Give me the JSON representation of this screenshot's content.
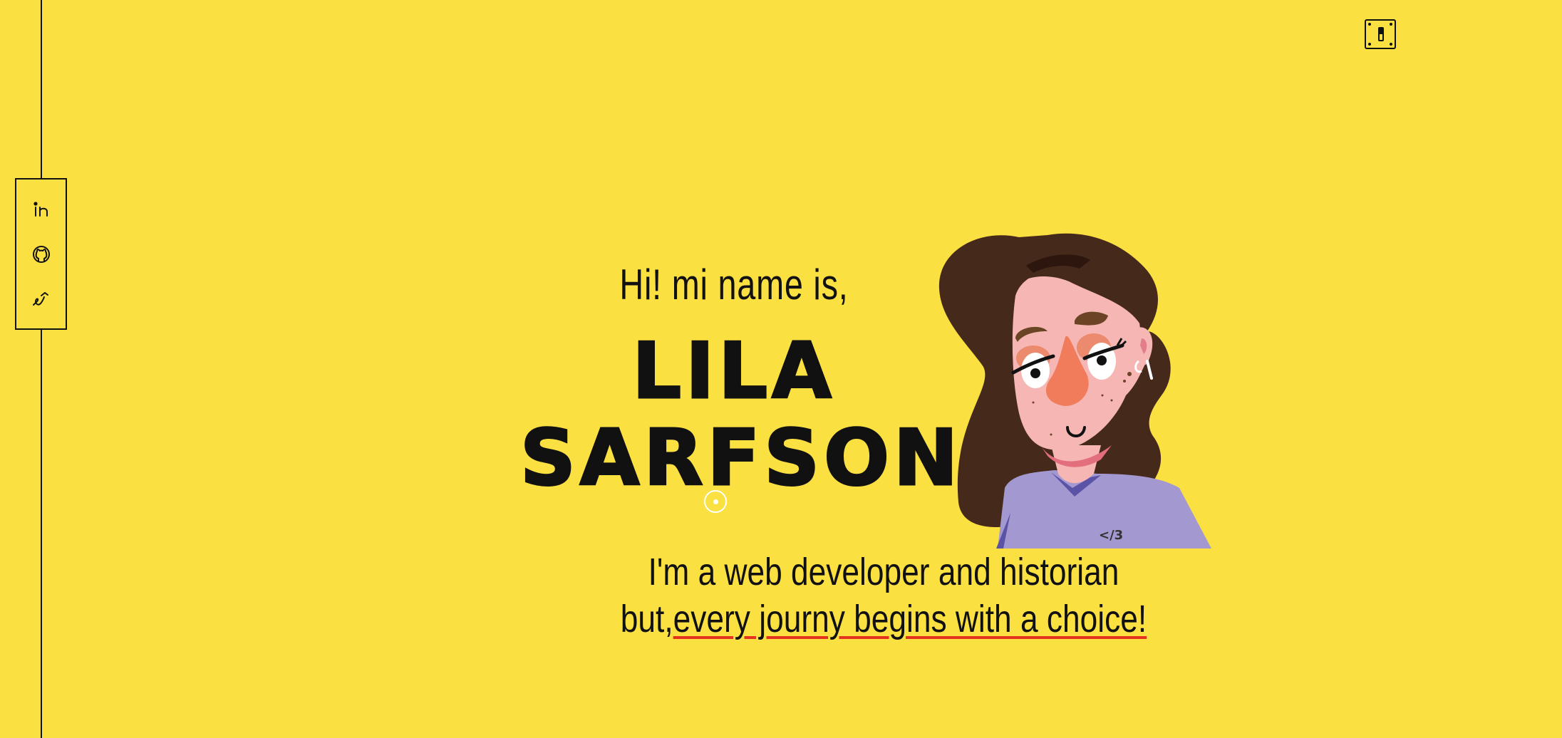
{
  "social": {
    "items": [
      {
        "name": "linkedin",
        "icon": "linkedin-icon"
      },
      {
        "name": "github",
        "icon": "github-icon"
      },
      {
        "name": "portfolio",
        "icon": "signature-icon"
      }
    ]
  },
  "theme_toggle": {
    "icon": "light-switch-icon"
  },
  "hero": {
    "greeting": "Hi! mi name is,",
    "first_name": "LILA",
    "last_name": "SARFSON",
    "tagline_plain": "I'm a web developer and historian but,",
    "tagline_highlight": "every journy begins with a choice!"
  },
  "avatar": {
    "shirt_text": "</3"
  },
  "colors": {
    "background": "#fbe042",
    "ink": "#111111",
    "underline": "#e5321e",
    "hair": "#45291a",
    "skin": "#f6b7b4",
    "shirt": "#a398cf"
  }
}
